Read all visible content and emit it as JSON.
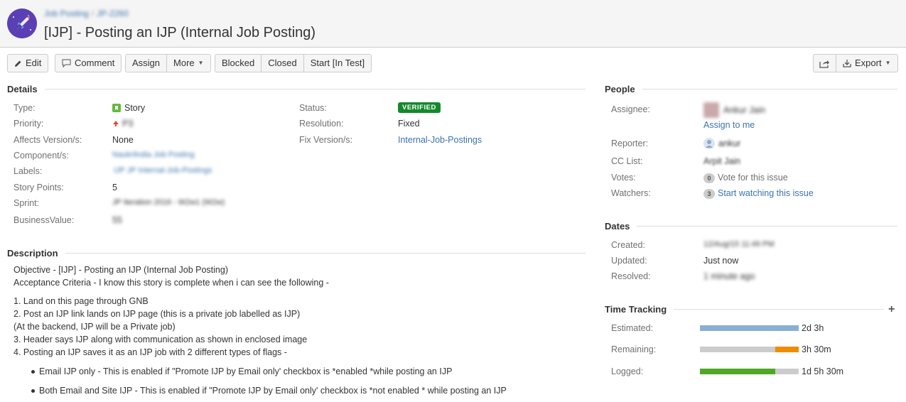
{
  "header": {
    "breadcrumb_project": "Job Posting",
    "breadcrumb_key": "JP-2260",
    "title": "[IJP] - Posting an IJP (Internal Job Posting)"
  },
  "toolbar": {
    "edit": "Edit",
    "comment": "Comment",
    "assign": "Assign",
    "more": "More",
    "blocked": "Blocked",
    "closed": "Closed",
    "start_in_test": "Start [In Test]",
    "export": "Export"
  },
  "details": {
    "heading": "Details",
    "type_label": "Type:",
    "type_value": "Story",
    "priority_label": "Priority:",
    "priority_value": "P3",
    "affects_label": "Affects Version/s:",
    "affects_value": "None",
    "component_label": "Component/s:",
    "component_value": "Naukrilndia Job Posting",
    "labels_label": "Labels:",
    "labels_value": "IJP   JP    Internal-Job-Postings",
    "story_points_label": "Story Points:",
    "story_points_value": "5",
    "sprint_label": "Sprint:",
    "sprint_value": "JP Iteration 2016 - W2w1 (W2w)",
    "business_label": "BusinessValue:",
    "business_value": "55",
    "status_label": "Status:",
    "status_value": "VERIFIED",
    "resolution_label": "Resolution:",
    "resolution_value": "Fixed",
    "fix_label": "Fix Version/s:",
    "fix_value": "Internal-Job-Postings"
  },
  "description": {
    "heading": "Description",
    "lines": [
      "Objective - [IJP] - Posting an IJP (Internal Job Posting)",
      "Acceptance Criteria - I know this story is complete when i can see the following -",
      "1. Land on this page through GNB",
      "2. Post an IJP link lands on IJP page (this is a private job labelled as IJP)",
      "(At the backend, IJP will be a Private job)",
      "3. Header says IJP along with communication as shown in enclosed image",
      "4. Posting an IJP saves it as an IJP job with 2 different types of flags -"
    ],
    "bullets": [
      "Email IJP only - This is enabled if \"Promote IJP by Email only' checkbox is *enabled *while posting an IJP",
      "Both Email and Site IJP - This is enabled if \"Promote IJP by Email only' checkbox is *not enabled * while posting an IJP"
    ]
  },
  "people": {
    "heading": "People",
    "assignee_label": "Assignee:",
    "assignee_value": "Ankur Jain",
    "assign_to_me": "Assign to me",
    "reporter_label": "Reporter:",
    "reporter_value": "ankur",
    "cc_label": "CC List:",
    "cc_value": "Arpit Jain",
    "votes_label": "Votes:",
    "votes_count": "0",
    "votes_link": "Vote for this issue",
    "watchers_label": "Watchers:",
    "watchers_count": "3",
    "watchers_link": "Start watching this issue"
  },
  "dates": {
    "heading": "Dates",
    "created_label": "Created:",
    "created_value": "12/Aug/15 11:49 PM",
    "updated_label": "Updated:",
    "updated_value": "Just now",
    "resolved_label": "Resolved:",
    "resolved_value": "1 minute ago"
  },
  "time_tracking": {
    "heading": "Time Tracking",
    "estimated_label": "Estimated:",
    "estimated_value": "2d 3h",
    "remaining_label": "Remaining:",
    "remaining_value": "3h 30m",
    "logged_label": "Logged:",
    "logged_value": "1d 5h 30m",
    "estimated_fraction": 1.0,
    "remaining_fraction": 0.24,
    "logged_fraction": 0.76
  },
  "colors": {
    "verified": "#14892c",
    "link": "#3b73af",
    "estimated": "#89afd7",
    "remaining": "#ec8e00",
    "logged": "#51a825"
  }
}
